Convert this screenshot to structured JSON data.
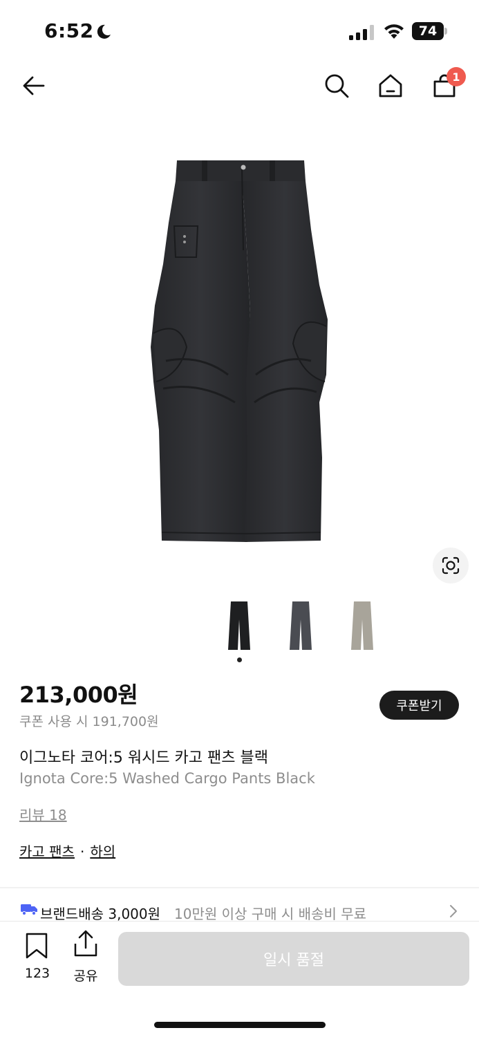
{
  "status_bar": {
    "time": "6:52",
    "battery": "74",
    "icons": [
      "moon-icon",
      "cellular-signal-icon",
      "wifi-icon",
      "battery-icon"
    ]
  },
  "nav": {
    "icons": [
      "back-arrow-icon",
      "search-icon",
      "home-icon",
      "shopping-bag-icon"
    ],
    "cart_count": "1"
  },
  "product": {
    "price": "213,000원",
    "coupon_price": "쿠폰 사용 시 191,700원",
    "coupon_button": "쿠폰받기",
    "name_ko": "이그노타 코어:5 워시드 카고 팬츠 블랙",
    "name_en": "Ignota Core:5 Washed Cargo Pants Black",
    "review_link": "리뷰 18",
    "categories": [
      "카고 팬츠",
      "하의"
    ],
    "category_separator": "·",
    "color_thumbnails": [
      {
        "color": "#1e1f21",
        "selected": true
      },
      {
        "color": "#4a4c52",
        "selected": false
      },
      {
        "color": "#a8a49a",
        "selected": false
      }
    ]
  },
  "shipping": {
    "label": "브랜드배송 3,000원",
    "note": "10만원 이상 구매 시 배송비 무료",
    "truck_color": "#4d63f5"
  },
  "bottom_bar": {
    "bookmark_count": "123",
    "share_label": "공유",
    "soldout_label": "일시 품절"
  }
}
